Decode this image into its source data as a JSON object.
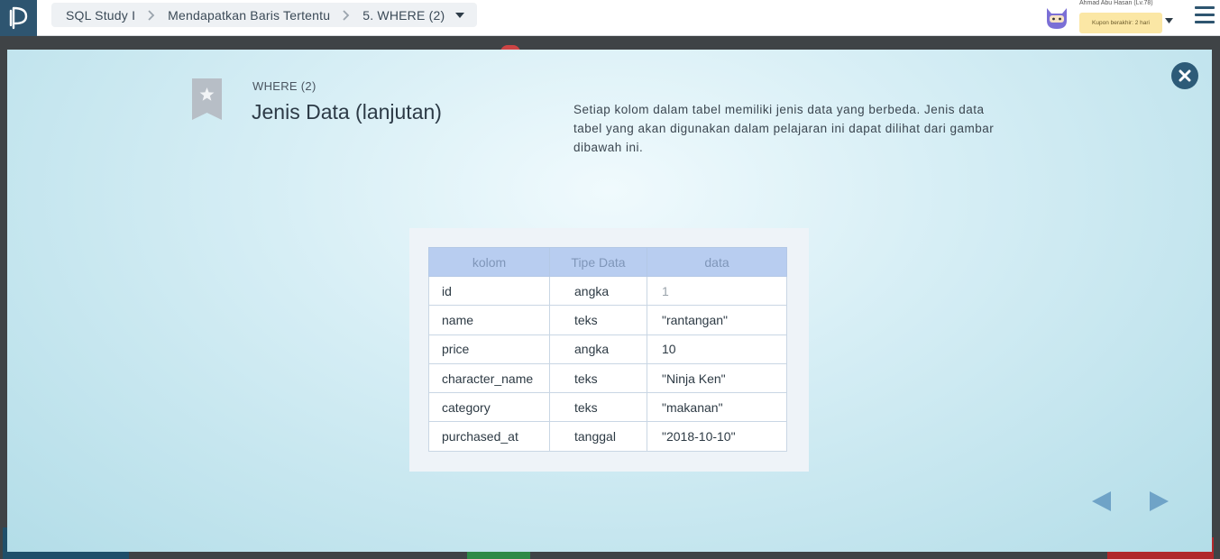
{
  "header": {
    "breadcrumbs": [
      {
        "label": "SQL Study I"
      },
      {
        "label": "Mendapatkan Baris Tertentu"
      },
      {
        "label": "5. WHERE (2)"
      }
    ],
    "user_name": "Ahmad Abu Hasan (Lv.78)",
    "coupon_text": "Kupon berakhir: 2 hari"
  },
  "slide": {
    "kicker": "WHERE (2)",
    "title": "Jenis Data (lanjutan)",
    "description": "Setiap kolom dalam tabel memiliki jenis data yang berbeda. Jenis data tabel yang akan digunakan dalam pelajaran ini dapat dilihat dari gambar dibawah ini.",
    "table": {
      "headers": [
        "kolom",
        "Tipe Data",
        "data"
      ],
      "rows": [
        [
          "id",
          "angka",
          "1"
        ],
        [
          "name",
          "teks",
          "\"rantangan\""
        ],
        [
          "price",
          "angka",
          "10"
        ],
        [
          "character_name",
          "teks",
          "\"Ninja Ken\""
        ],
        [
          "category",
          "teks",
          "\"makanan\""
        ],
        [
          "purchased_at",
          "tanggal",
          "\"2018-10-10\""
        ]
      ]
    }
  },
  "icons": {
    "logo": "progate-logo-icon",
    "breadcrumb_separator": "chevron-right-icon",
    "dropdown": "caret-down-icon",
    "avatar": "ninja-cat-avatar-icon",
    "menu": "hamburger-menu-icon",
    "bookmark": "star-bookmark-icon",
    "close": "close-circle-icon",
    "prev": "triangle-left-icon",
    "next": "triangle-right-icon"
  },
  "colors": {
    "brand": "#2e5570",
    "table_header_bg": "#b8cdf0",
    "nav_arrow": "#6fa3c7"
  }
}
